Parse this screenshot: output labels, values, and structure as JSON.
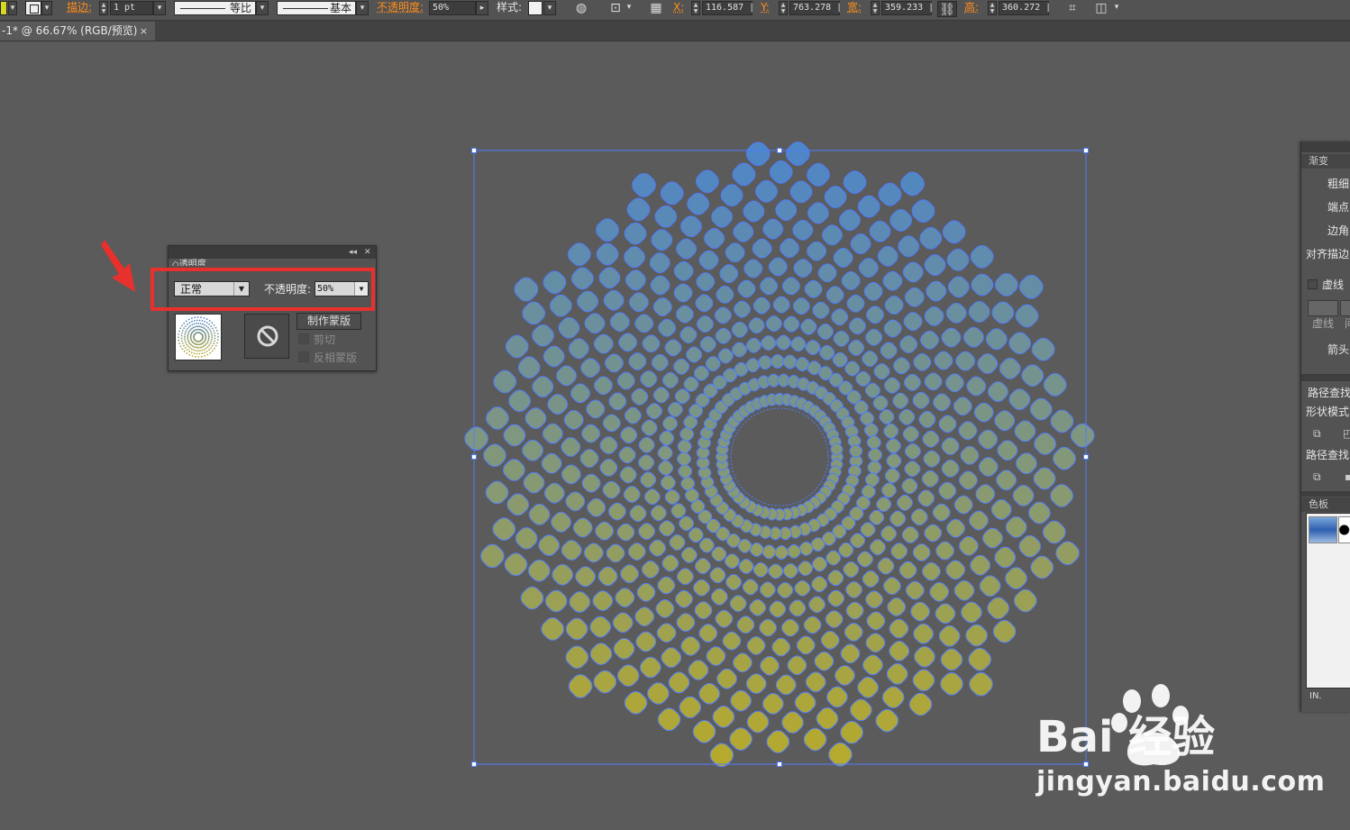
{
  "toolbar": {
    "stroke_label": "描边:",
    "stroke_weight": "1 pt",
    "stroke_profile": "等比",
    "brush": "基本",
    "opacity_label": "不透明度:",
    "opacity_value": "50%",
    "style_label": "样式:",
    "x_label": "X:",
    "x_value": "116.587 |",
    "y_label": "Y:",
    "y_value": "763.278 |",
    "w_label": "宽:",
    "w_value": "359.233 |",
    "h_label": "高:",
    "h_value": "360.272 |",
    "icons": [
      "fill-swatch-icon",
      "stroke-swatch-icon",
      "recolor-icon",
      "transform-reference-icon",
      "align-grid-icon",
      "link-icon",
      "transform-bounds-icon",
      "isolate-icon"
    ]
  },
  "document_tab": {
    "title": "-1* @ 66.67% (RGB/预览)",
    "close": "×"
  },
  "transparency_panel": {
    "tab_label": "◇透明度",
    "blend_mode": "正常",
    "opacity_label": "不透明度:",
    "opacity_value": "50%",
    "make_mask": "制作蒙版",
    "clip_label": "剪切",
    "invert_label": "反相蒙版",
    "collapse_icon": "◂◂",
    "close_icon": "✕"
  },
  "right_panel": {
    "tab1": "渐变",
    "weight": "粗细",
    "cap": "端点",
    "corner": "边角",
    "align_stroke": "对齐描边",
    "dashed": "虚线",
    "dash_label": "虚线",
    "gap_label": "间",
    "arrowhead": "箭头",
    "pathfinder": "路径查找",
    "shape_modes": "形状模式",
    "pathfinders": "路径查找",
    "swatches_tab": "色板",
    "swatch_lib": "IN."
  },
  "watermark": {
    "brand": "Bai  经验",
    "url": "jingyan.baidu.com"
  },
  "colors": {
    "canvas": "#5b5b5b",
    "selection": "#4f7cff",
    "highlight": "#e8302c",
    "gradient_start": "#4f86c6",
    "gradient_end": "#b8aa2a"
  }
}
